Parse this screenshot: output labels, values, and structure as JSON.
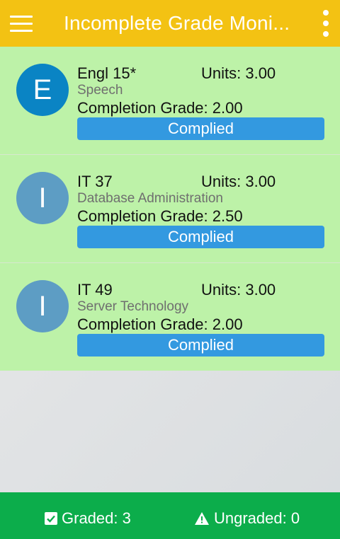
{
  "appbar": {
    "title": "Incomplete Grade Moni..."
  },
  "icons": {
    "menu": "hamburger-menu-icon",
    "overflow": "more-vert-icon",
    "graded": "checkbox-icon",
    "ungraded": "warning-icon"
  },
  "courses": [
    {
      "initial": "E",
      "code": "Engl 15*",
      "units": "Units: 3.00",
      "subject": "Speech",
      "grade": "Completion Grade: 2.00",
      "status": "Complied",
      "avatar_color": "#0a84c4"
    },
    {
      "initial": "I",
      "code": "IT 37",
      "units": "Units: 3.00",
      "subject": "Database Administration",
      "grade": "Completion Grade: 2.50",
      "status": "Complied",
      "avatar_color": "#5d9dc4"
    },
    {
      "initial": "I",
      "code": "IT 49",
      "units": "Units: 3.00",
      "subject": "Server Technology",
      "grade": "Completion Grade: 2.00",
      "status": "Complied",
      "avatar_color": "#5d9dc4"
    }
  ],
  "footer": {
    "graded": "Graded: 3",
    "ungraded": "Ungraded: 0"
  },
  "colors": {
    "appbar": "#f3c213",
    "card": "#bdf2a8",
    "button": "#3399e0",
    "footer": "#0cad4b"
  }
}
